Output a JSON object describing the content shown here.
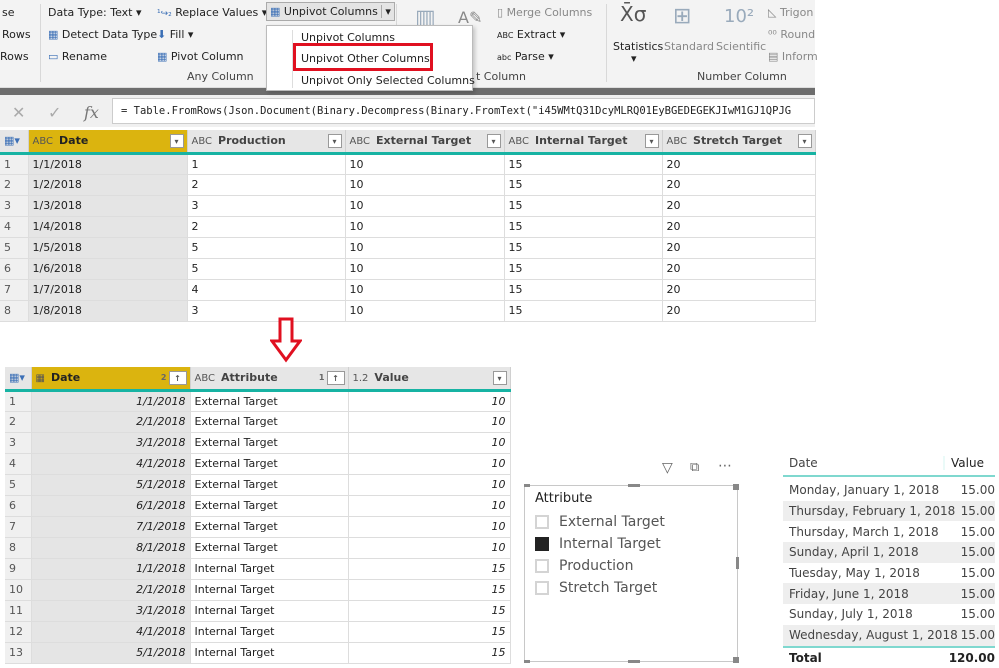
{
  "ribbon": {
    "left_items": [
      "se",
      "Rows",
      "Rows"
    ],
    "data_type": "Data Type: Text",
    "detect": "Detect Data Type",
    "rename": "Rename",
    "replace": "Replace Values",
    "fill": "Fill",
    "pivot": "Pivot Column",
    "unpivot": "Unpivot Columns",
    "any_column_group": "Any Column",
    "merge": "Merge Columns",
    "extract": "Extract",
    "parse": "Parse",
    "text_column_group": "t Column",
    "statistics": "Statistics",
    "standard": "Standard",
    "scientific": "Scientific",
    "trig": "Trigon",
    "round": "Round",
    "info": "Inform",
    "number_column_group": "Number Column"
  },
  "menu": {
    "items": [
      "Unpivot Columns",
      "Unpivot Other Columns",
      "Unpivot Only Selected Columns"
    ],
    "highlighted": "Unpivot Other Columns"
  },
  "formula": "= Table.FromRows(Json.Document(Binary.Decompress(Binary.FromText(\"i45WMtQ31DcyMLRQ01EyBGEDEGEKJIwM1GJ1QPJG",
  "top_table": {
    "columns": [
      "Date",
      "Production",
      "External Target",
      "Internal Target",
      "Stretch Target"
    ],
    "rows": [
      [
        "1/1/2018",
        "1",
        "10",
        "15",
        "20"
      ],
      [
        "1/2/2018",
        "2",
        "10",
        "15",
        "20"
      ],
      [
        "1/3/2018",
        "3",
        "10",
        "15",
        "20"
      ],
      [
        "1/4/2018",
        "2",
        "10",
        "15",
        "20"
      ],
      [
        "1/5/2018",
        "5",
        "10",
        "15",
        "20"
      ],
      [
        "1/6/2018",
        "5",
        "10",
        "15",
        "20"
      ],
      [
        "1/7/2018",
        "4",
        "10",
        "15",
        "20"
      ],
      [
        "1/8/2018",
        "3",
        "10",
        "15",
        "20"
      ]
    ]
  },
  "bottom_table": {
    "columns": [
      "Date",
      "Attribute",
      "Value"
    ],
    "sort_badges": [
      "2",
      "1"
    ],
    "value_type": "1.2",
    "rows": [
      [
        "1/1/2018",
        "External Target",
        "10"
      ],
      [
        "2/1/2018",
        "External Target",
        "10"
      ],
      [
        "3/1/2018",
        "External Target",
        "10"
      ],
      [
        "4/1/2018",
        "External Target",
        "10"
      ],
      [
        "5/1/2018",
        "External Target",
        "10"
      ],
      [
        "6/1/2018",
        "External Target",
        "10"
      ],
      [
        "7/1/2018",
        "External Target",
        "10"
      ],
      [
        "8/1/2018",
        "External Target",
        "10"
      ],
      [
        "1/1/2018",
        "Internal Target",
        "15"
      ],
      [
        "2/1/2018",
        "Internal Target",
        "15"
      ],
      [
        "3/1/2018",
        "Internal Target",
        "15"
      ],
      [
        "4/1/2018",
        "Internal Target",
        "15"
      ],
      [
        "5/1/2018",
        "Internal Target",
        "15"
      ]
    ]
  },
  "slicer": {
    "title": "Attribute",
    "items": [
      {
        "label": "External Target",
        "checked": false
      },
      {
        "label": "Internal Target",
        "checked": true
      },
      {
        "label": "Production",
        "checked": false
      },
      {
        "label": "Stretch Target",
        "checked": false
      }
    ],
    "icons": [
      "filter-icon",
      "focus-mode-icon",
      "more-options-icon"
    ]
  },
  "visual_table": {
    "headers": [
      "Date",
      "Value"
    ],
    "rows": [
      [
        "Monday, January 1, 2018",
        "15.00"
      ],
      [
        "Thursday, February 1, 2018",
        "15.00"
      ],
      [
        "Thursday, March 1, 2018",
        "15.00"
      ],
      [
        "Sunday, April 1, 2018",
        "15.00"
      ],
      [
        "Tuesday, May 1, 2018",
        "15.00"
      ],
      [
        "Friday, June 1, 2018",
        "15.00"
      ],
      [
        "Sunday, July 1, 2018",
        "15.00"
      ],
      [
        "Wednesday, August 1, 2018",
        "15.00"
      ]
    ],
    "total_label": "Total",
    "total_value": "120.00"
  },
  "colors": {
    "selected_header": "#dbb40f",
    "accent": "#17b3a3",
    "highlight_box": "#e01020",
    "arrow": "#e01020"
  }
}
